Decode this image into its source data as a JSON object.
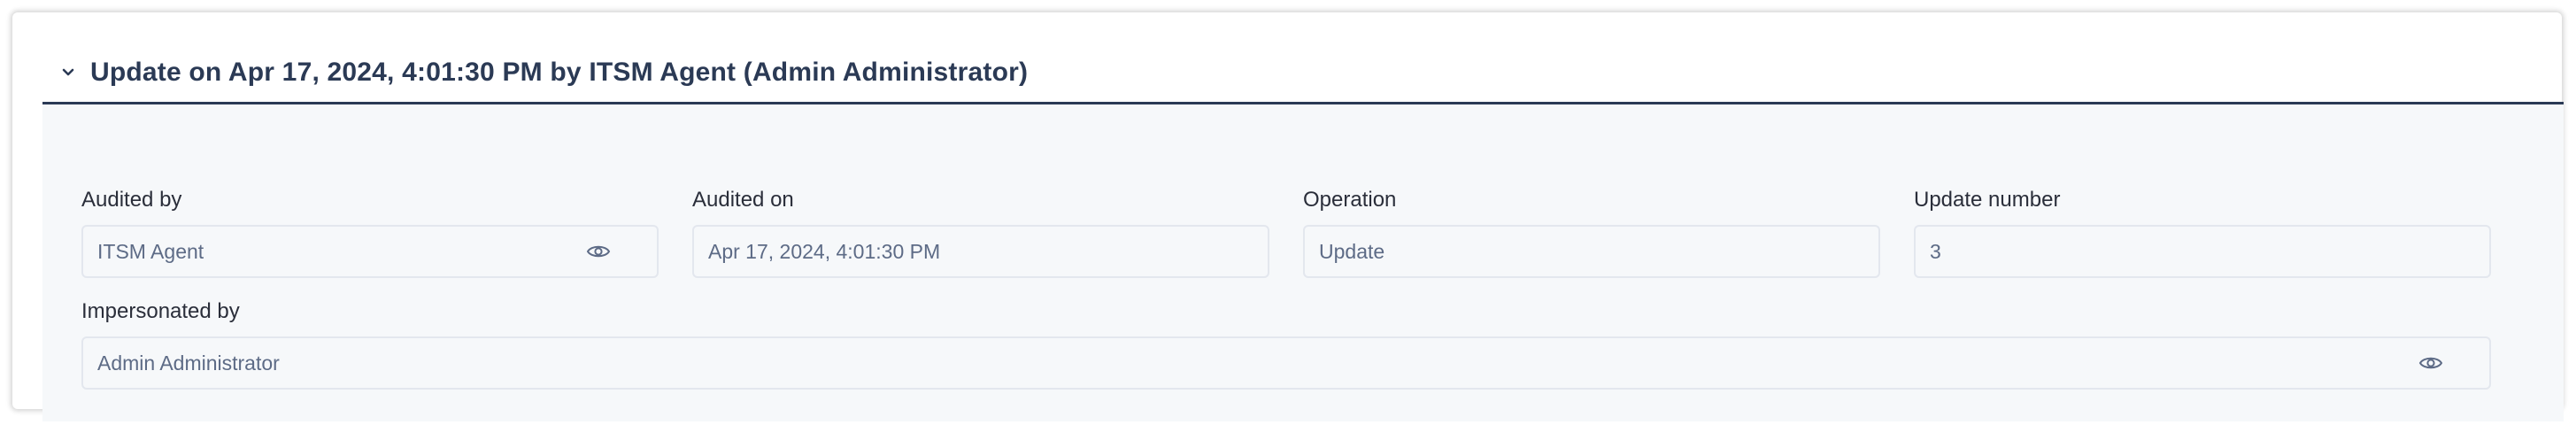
{
  "header": {
    "title": "Update on Apr 17, 2024, 4:01:30 PM by ITSM Agent (Admin Administrator)",
    "expanded_icon": "chevron-down-icon"
  },
  "fields": {
    "audited_by": {
      "label": "Audited by",
      "value": "ITSM Agent",
      "icon": "eye-icon"
    },
    "audited_on": {
      "label": "Audited on",
      "value": "Apr 17, 2024, 4:01:30 PM"
    },
    "operation": {
      "label": "Operation",
      "value": "Update"
    },
    "update_number": {
      "label": "Update number",
      "value": "3"
    },
    "impersonated_by": {
      "label": "Impersonated by",
      "value": "Admin Administrator",
      "icon": "eye-icon"
    }
  },
  "colors": {
    "header_text": "#2b3a55",
    "panel_background": "#f6f8fa",
    "input_border": "#e3e7ee",
    "value_text": "#5d6b86"
  }
}
